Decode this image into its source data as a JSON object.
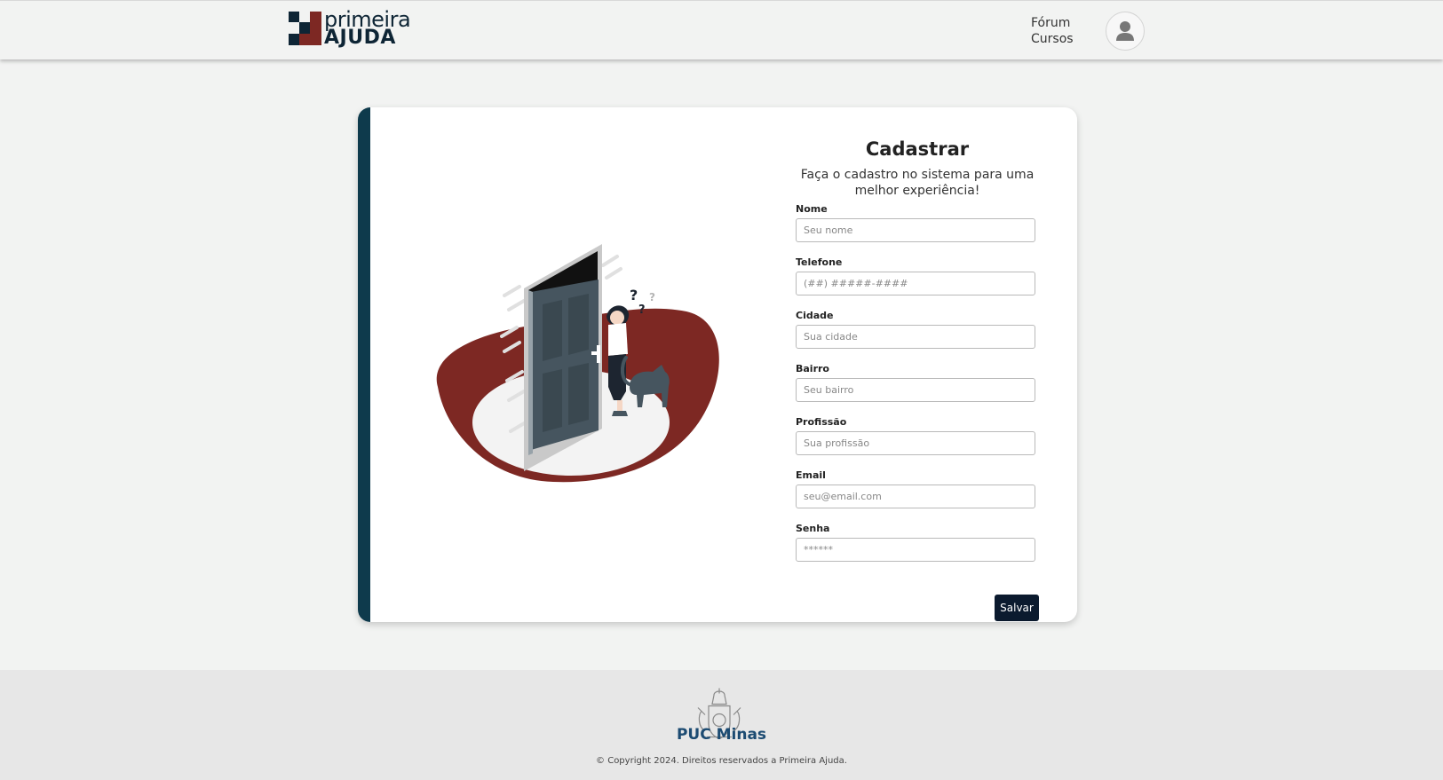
{
  "header": {
    "logo": {
      "top": "primeira",
      "bottom": "AJUDA"
    },
    "nav": [
      {
        "label": "Fórum"
      },
      {
        "label": "Cursos"
      }
    ]
  },
  "form": {
    "title": "Cadastrar",
    "subtitle": "Faça o cadastro no sistema para uma melhor experiência!",
    "fields": [
      {
        "label": "Nome",
        "placeholder": "Seu nome"
      },
      {
        "label": "Telefone",
        "placeholder": "(##) #####-####"
      },
      {
        "label": "Cidade",
        "placeholder": "Sua cidade"
      },
      {
        "label": "Bairro",
        "placeholder": "Seu bairro"
      },
      {
        "label": "Profissão",
        "placeholder": "Sua profissão"
      },
      {
        "label": "Email",
        "placeholder": "seu@email.com"
      },
      {
        "label": "Senha",
        "placeholder": "******"
      }
    ],
    "submit_label": "Salvar"
  },
  "footer": {
    "brand": "PUC Minas",
    "copyright": "© Copyright 2024. Direitos reservados a Primeira Ajuda."
  },
  "colors": {
    "brand_dark": "#0e2535",
    "accent_red": "#7d2823",
    "card_accent": "#0e3a4c",
    "button": "#0b1a2e"
  }
}
